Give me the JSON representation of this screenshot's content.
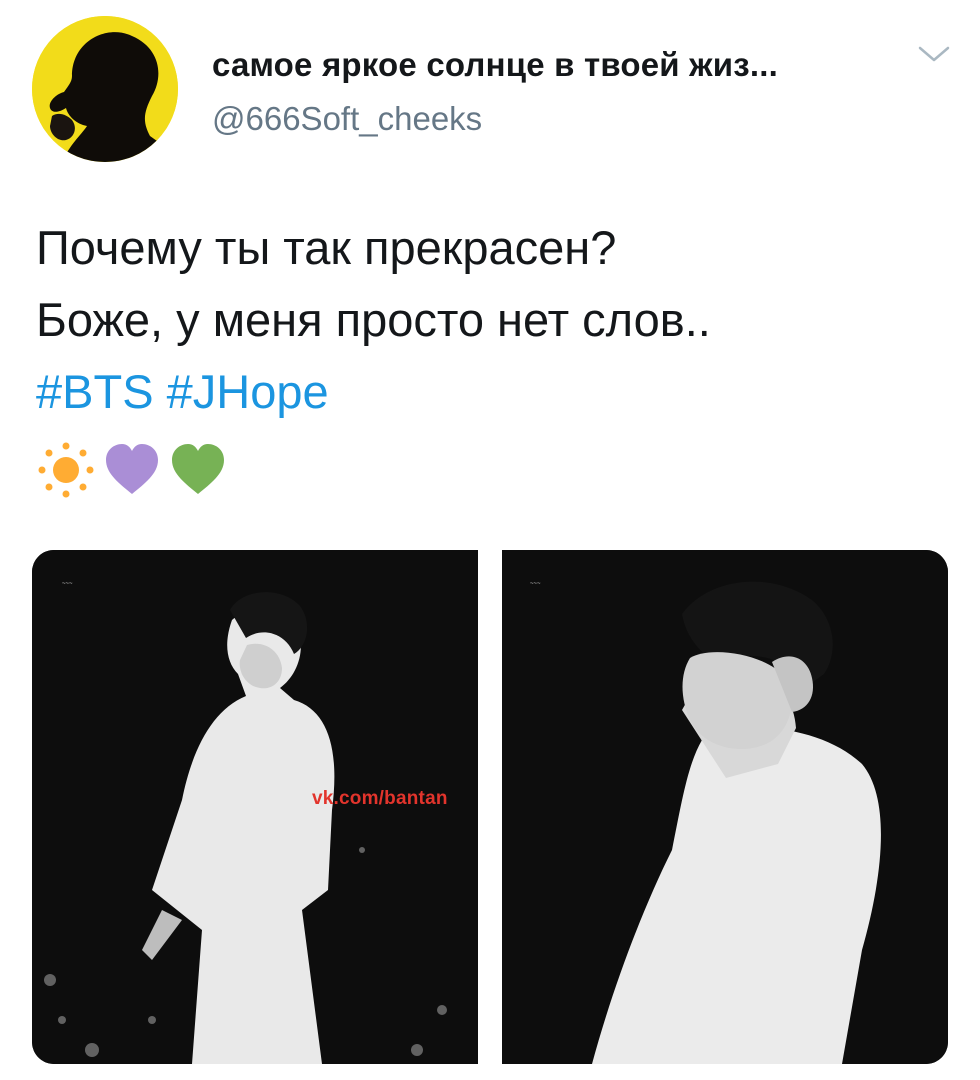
{
  "tweet": {
    "display_name": "самое яркое солнце в твоей жиз...",
    "handle": "@666Soft_cheeks",
    "text_line_1": "Почему ты так прекрасен?",
    "text_line_2": "Боже, у меня просто нет слов..",
    "hashtags": [
      "#BTS",
      "#JHope"
    ],
    "emojis": [
      "sun",
      "purple-heart",
      "green-heart"
    ]
  },
  "media": {
    "watermark": "vk.com/bantan"
  },
  "colors": {
    "hashtag": "#1b95e0",
    "avatar_bg": "#f2dc1a",
    "watermark": "#e2342c",
    "purple_heart": "#aa8ed6",
    "green_heart": "#77b255",
    "sun": "#ffac33"
  }
}
